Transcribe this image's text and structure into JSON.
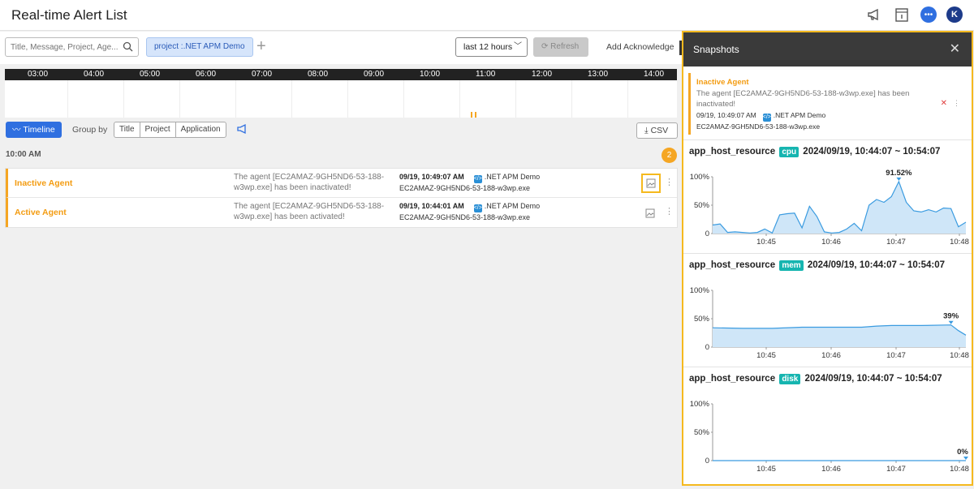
{
  "header": {
    "title": "Real-time Alert List"
  },
  "toolbar": {
    "search_placeholder": "Title, Message, Project, Age...",
    "filter_chip": "project :.NET APM Demo",
    "add_filter": "+",
    "time_range": "last 12 hours",
    "refresh_label": "Refresh",
    "add_ack_label": "Add Acknowledge"
  },
  "timeline": {
    "hours": [
      "03:00",
      "04:00",
      "05:00",
      "06:00",
      "07:00",
      "08:00",
      "09:00",
      "10:00",
      "11:00",
      "12:00",
      "13:00",
      "14:00"
    ]
  },
  "controls": {
    "timeline_label": "Timeline",
    "group_by_label": "Group by",
    "group_by_options": [
      "Title",
      "Project",
      "Application"
    ],
    "csv_label": "CSV"
  },
  "list": {
    "section_time": "10:00 AM",
    "count": "2",
    "alerts": [
      {
        "title": "Inactive Agent",
        "message": "The agent [EC2AMAZ-9GH5ND6-53-188-w3wp.exe] has been inactivated!",
        "time": "09/19, 10:49:07 AM",
        "project": ".NET APM Demo",
        "agent": "EC2AMAZ-9GH5ND6-53-188-w3wp.exe"
      },
      {
        "title": "Active Agent",
        "message": "The agent [EC2AMAZ-9GH5ND6-53-188-w3wp.exe] has been activated!",
        "time": "09/19, 10:44:01 AM",
        "project": ".NET APM Demo",
        "agent": "EC2AMAZ-9GH5ND6-53-188-w3wp.exe"
      }
    ]
  },
  "snapshots": {
    "title": "Snapshots",
    "alert": {
      "title": "Inactive Agent",
      "message": "The agent [EC2AMAZ-9GH5ND6-53-188-w3wp.exe] has been inactivated!",
      "time": "09/19, 10:49:07 AM",
      "project": ".NET APM Demo",
      "agent": "EC2AMAZ-9GH5ND6-53-188-w3wp.exe"
    },
    "resources": [
      {
        "name": "app_host_resource",
        "metric": "cpu",
        "range": "2024/09/19, 10:44:07 ~ 10:54:07"
      },
      {
        "name": "app_host_resource",
        "metric": "mem",
        "range": "2024/09/19, 10:44:07 ~ 10:54:07"
      },
      {
        "name": "app_host_resource",
        "metric": "disk",
        "range": "2024/09/19, 10:44:07 ~ 10:54:07"
      }
    ]
  },
  "chart_data": [
    {
      "type": "area",
      "title": "cpu",
      "y_ticks": [
        "100%",
        "50%",
        "0"
      ],
      "x_ticks": [
        "10:45",
        "10:46",
        "10:47",
        "10:48"
      ],
      "ylim": [
        0,
        100
      ],
      "peak_label": "91.52%",
      "x": [
        10.733,
        10.738,
        10.743,
        10.748,
        10.753,
        10.758,
        10.763,
        10.768,
        10.773,
        10.778,
        10.783,
        10.788,
        10.793,
        10.798,
        10.803,
        10.808,
        10.813,
        10.818,
        10.823,
        10.828,
        10.833,
        10.838,
        10.843,
        10.848,
        10.853,
        10.858,
        10.863,
        10.868,
        10.873,
        10.878,
        10.883,
        10.888,
        10.893,
        10.898,
        10.903
      ],
      "values": [
        15,
        17,
        2,
        3,
        2,
        1,
        2,
        8,
        1,
        33,
        35,
        36,
        10,
        48,
        30,
        3,
        1,
        2,
        8,
        18,
        5,
        50,
        60,
        55,
        65,
        91.52,
        55,
        40,
        38,
        42,
        38,
        45,
        44,
        12,
        20
      ]
    },
    {
      "type": "area",
      "title": "mem",
      "y_ticks": [
        "100%",
        "50%",
        "0"
      ],
      "x_ticks": [
        "10:45",
        "10:46",
        "10:47",
        "10:48"
      ],
      "ylim": [
        0,
        100
      ],
      "peak_label": "39%",
      "x": [
        10.733,
        10.753,
        10.773,
        10.793,
        10.813,
        10.833,
        10.843,
        10.853,
        10.873,
        10.893,
        10.898,
        10.903
      ],
      "values": [
        34,
        33,
        33,
        35,
        35,
        35,
        37,
        38,
        38,
        39,
        29,
        21
      ]
    },
    {
      "type": "area",
      "title": "disk",
      "y_ticks": [
        "100%",
        "50%",
        "0"
      ],
      "x_ticks": [
        "10:45",
        "10:46",
        "10:47",
        "10:48"
      ],
      "ylim": [
        0,
        100
      ],
      "peak_label": "0%",
      "x": [
        10.733,
        10.903
      ],
      "values": [
        0,
        0
      ]
    }
  ]
}
